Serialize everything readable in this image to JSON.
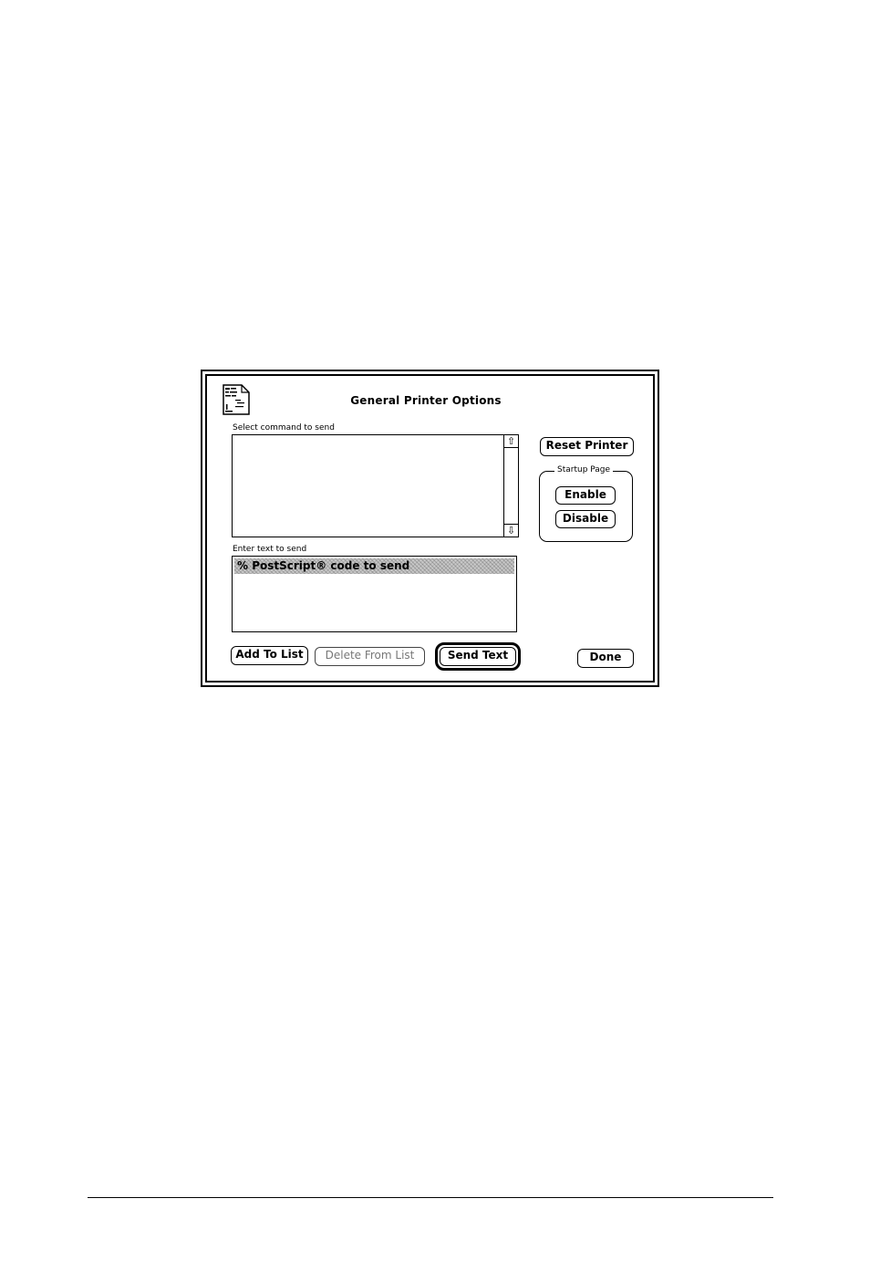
{
  "dialog": {
    "title": "General Printer Options",
    "icon": "printer-document-icon"
  },
  "command_list": {
    "label": "Select command to send",
    "items": [],
    "scroll_up_icon": "⇧",
    "scroll_down_icon": "⇩"
  },
  "text_entry": {
    "label": "Enter text to send",
    "value": "% PostScript® code to send"
  },
  "buttons": {
    "reset_printer": "Reset Printer",
    "add_to_list": "Add To List",
    "delete_from_list": "Delete From List",
    "send_text": "Send Text",
    "done": "Done"
  },
  "startup_page": {
    "title": "Startup Page",
    "enable": "Enable",
    "disable": "Disable"
  }
}
